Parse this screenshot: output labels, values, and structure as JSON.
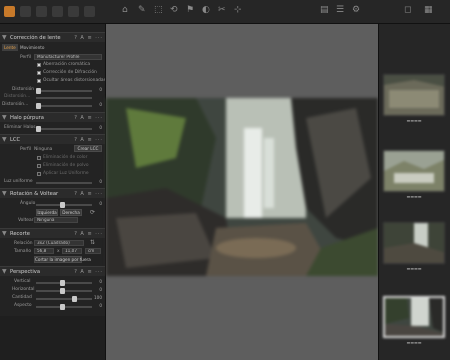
{
  "left_panel": {
    "lens": {
      "title": "Corrección de lente",
      "tabs": [
        "Lente",
        "Movimiento"
      ],
      "perfil_label": "Perfil",
      "perfil_value": "Manufacturer Profile",
      "options": [
        "Aberración cromática",
        "Corrección de Difracción",
        "Ocultar áreas distorsionadas"
      ],
      "distortion_label": "Distorsión",
      "distortion_value": "0",
      "row2_label": "Distorsión...",
      "row3_label": "Distorsión...",
      "row3_value": "0"
    },
    "purple": {
      "title": "Halo púrpura",
      "label": "Eliminar Halos",
      "value": "0"
    },
    "lcc": {
      "title": "LCC",
      "perfil_label": "Perfil",
      "perfil_value": "Ninguna",
      "create_button": "Crear LCC",
      "options": [
        "Eliminación de color",
        "Eliminación de polvo",
        "Aplicar Luz Uniforme"
      ],
      "uniform_label": "Luz uniforme",
      "uniform_value": "0"
    },
    "rotate": {
      "title": "Rotación & Voltear",
      "angle_label": "Ángulo",
      "angle_value": "0",
      "left_button": "Izquierda",
      "right_button": "Derecha",
      "flip_label": "Voltear",
      "flip_value": "Ninguna"
    },
    "crop": {
      "title": "Recorte",
      "ratio_label": "Relación",
      "ratio_value": "3x2 (Cuadrado)",
      "size_label": "Tamaño",
      "size_w": "56,8",
      "size_x": "x",
      "size_h": "11,07",
      "size_unit": "cm",
      "cut_button": "Cortar la imagen por fuera"
    },
    "perspective": {
      "title": "Perspectiva",
      "vertical_label": "Vertical",
      "vertical_value": "0",
      "horizontal_label": "Horizontal",
      "horizontal_value": "0",
      "amount_label": "Cantidad",
      "amount_value": "100",
      "aspect_label": "Aspecto",
      "aspect_value": "0"
    },
    "header_icons": "? A ≡ ···"
  },
  "toolbar_glyphs": [
    "⌂",
    "✎",
    "⬚",
    "⟲",
    "⚑",
    "◐",
    "✂",
    "⊹",
    "▤",
    "☰",
    "⚙",
    "◻",
    "▦"
  ],
  "icons": [
    "chevron-down-icon",
    "help-icon",
    "auto-icon",
    "list-icon",
    "more-icon",
    "rotate-icon"
  ],
  "accent_color": "#e6a14a"
}
